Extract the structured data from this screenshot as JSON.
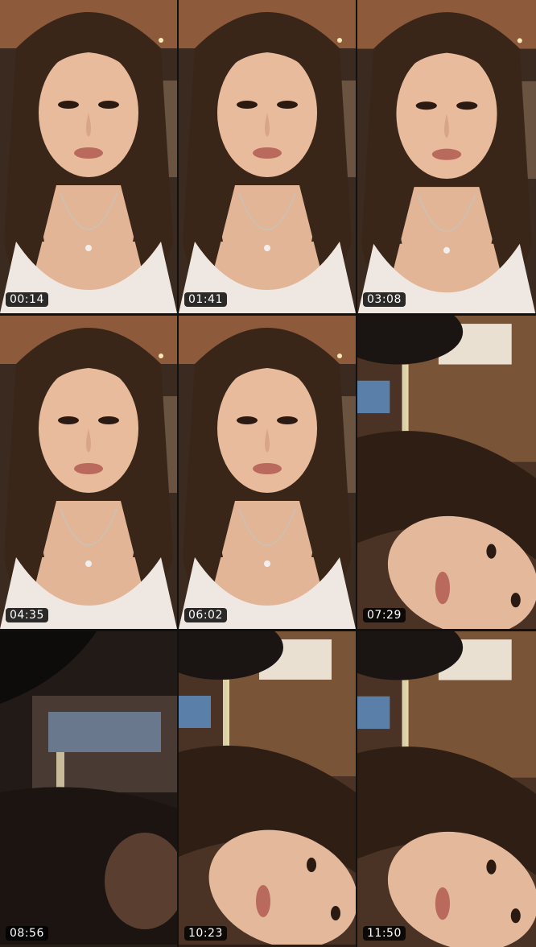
{
  "tiles": [
    {
      "timestamp": "00:14",
      "scene": "portrait-face-icon"
    },
    {
      "timestamp": "01:41",
      "scene": "portrait-face-icon"
    },
    {
      "timestamp": "03:08",
      "scene": "portrait-face-icon"
    },
    {
      "timestamp": "04:35",
      "scene": "portrait-face-icon"
    },
    {
      "timestamp": "06:02",
      "scene": "portrait-face-icon"
    },
    {
      "timestamp": "07:29",
      "scene": "rotated-portrait-icon"
    },
    {
      "timestamp": "08:56",
      "scene": "motion-blur-icon"
    },
    {
      "timestamp": "10:23",
      "scene": "rotated-portrait-icon"
    },
    {
      "timestamp": "11:50",
      "scene": "rotated-portrait-icon"
    }
  ],
  "colors": {
    "background": "#111111",
    "badge_bg": "#000000",
    "badge_text": "#ffffff",
    "skin": "#e0b497",
    "hair": "#3a2618",
    "top": "#efe8e2"
  }
}
